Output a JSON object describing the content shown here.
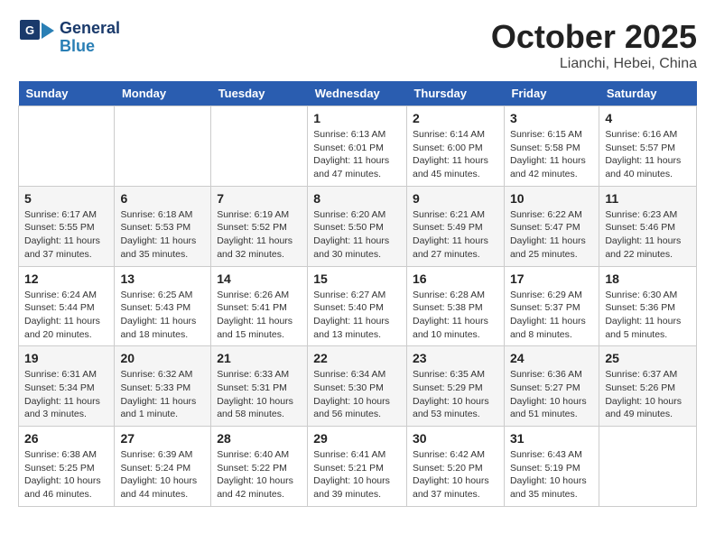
{
  "header": {
    "logo_line1": "General",
    "logo_line2": "Blue",
    "month": "October 2025",
    "location": "Lianchi, Hebei, China"
  },
  "days_of_week": [
    "Sunday",
    "Monday",
    "Tuesday",
    "Wednesday",
    "Thursday",
    "Friday",
    "Saturday"
  ],
  "weeks": [
    [
      {
        "day": "",
        "info": ""
      },
      {
        "day": "",
        "info": ""
      },
      {
        "day": "",
        "info": ""
      },
      {
        "day": "1",
        "info": "Sunrise: 6:13 AM\nSunset: 6:01 PM\nDaylight: 11 hours and 47 minutes."
      },
      {
        "day": "2",
        "info": "Sunrise: 6:14 AM\nSunset: 6:00 PM\nDaylight: 11 hours and 45 minutes."
      },
      {
        "day": "3",
        "info": "Sunrise: 6:15 AM\nSunset: 5:58 PM\nDaylight: 11 hours and 42 minutes."
      },
      {
        "day": "4",
        "info": "Sunrise: 6:16 AM\nSunset: 5:57 PM\nDaylight: 11 hours and 40 minutes."
      }
    ],
    [
      {
        "day": "5",
        "info": "Sunrise: 6:17 AM\nSunset: 5:55 PM\nDaylight: 11 hours and 37 minutes."
      },
      {
        "day": "6",
        "info": "Sunrise: 6:18 AM\nSunset: 5:53 PM\nDaylight: 11 hours and 35 minutes."
      },
      {
        "day": "7",
        "info": "Sunrise: 6:19 AM\nSunset: 5:52 PM\nDaylight: 11 hours and 32 minutes."
      },
      {
        "day": "8",
        "info": "Sunrise: 6:20 AM\nSunset: 5:50 PM\nDaylight: 11 hours and 30 minutes."
      },
      {
        "day": "9",
        "info": "Sunrise: 6:21 AM\nSunset: 5:49 PM\nDaylight: 11 hours and 27 minutes."
      },
      {
        "day": "10",
        "info": "Sunrise: 6:22 AM\nSunset: 5:47 PM\nDaylight: 11 hours and 25 minutes."
      },
      {
        "day": "11",
        "info": "Sunrise: 6:23 AM\nSunset: 5:46 PM\nDaylight: 11 hours and 22 minutes."
      }
    ],
    [
      {
        "day": "12",
        "info": "Sunrise: 6:24 AM\nSunset: 5:44 PM\nDaylight: 11 hours and 20 minutes."
      },
      {
        "day": "13",
        "info": "Sunrise: 6:25 AM\nSunset: 5:43 PM\nDaylight: 11 hours and 18 minutes."
      },
      {
        "day": "14",
        "info": "Sunrise: 6:26 AM\nSunset: 5:41 PM\nDaylight: 11 hours and 15 minutes."
      },
      {
        "day": "15",
        "info": "Sunrise: 6:27 AM\nSunset: 5:40 PM\nDaylight: 11 hours and 13 minutes."
      },
      {
        "day": "16",
        "info": "Sunrise: 6:28 AM\nSunset: 5:38 PM\nDaylight: 11 hours and 10 minutes."
      },
      {
        "day": "17",
        "info": "Sunrise: 6:29 AM\nSunset: 5:37 PM\nDaylight: 11 hours and 8 minutes."
      },
      {
        "day": "18",
        "info": "Sunrise: 6:30 AM\nSunset: 5:36 PM\nDaylight: 11 hours and 5 minutes."
      }
    ],
    [
      {
        "day": "19",
        "info": "Sunrise: 6:31 AM\nSunset: 5:34 PM\nDaylight: 11 hours and 3 minutes."
      },
      {
        "day": "20",
        "info": "Sunrise: 6:32 AM\nSunset: 5:33 PM\nDaylight: 11 hours and 1 minute."
      },
      {
        "day": "21",
        "info": "Sunrise: 6:33 AM\nSunset: 5:31 PM\nDaylight: 10 hours and 58 minutes."
      },
      {
        "day": "22",
        "info": "Sunrise: 6:34 AM\nSunset: 5:30 PM\nDaylight: 10 hours and 56 minutes."
      },
      {
        "day": "23",
        "info": "Sunrise: 6:35 AM\nSunset: 5:29 PM\nDaylight: 10 hours and 53 minutes."
      },
      {
        "day": "24",
        "info": "Sunrise: 6:36 AM\nSunset: 5:27 PM\nDaylight: 10 hours and 51 minutes."
      },
      {
        "day": "25",
        "info": "Sunrise: 6:37 AM\nSunset: 5:26 PM\nDaylight: 10 hours and 49 minutes."
      }
    ],
    [
      {
        "day": "26",
        "info": "Sunrise: 6:38 AM\nSunset: 5:25 PM\nDaylight: 10 hours and 46 minutes."
      },
      {
        "day": "27",
        "info": "Sunrise: 6:39 AM\nSunset: 5:24 PM\nDaylight: 10 hours and 44 minutes."
      },
      {
        "day": "28",
        "info": "Sunrise: 6:40 AM\nSunset: 5:22 PM\nDaylight: 10 hours and 42 minutes."
      },
      {
        "day": "29",
        "info": "Sunrise: 6:41 AM\nSunset: 5:21 PM\nDaylight: 10 hours and 39 minutes."
      },
      {
        "day": "30",
        "info": "Sunrise: 6:42 AM\nSunset: 5:20 PM\nDaylight: 10 hours and 37 minutes."
      },
      {
        "day": "31",
        "info": "Sunrise: 6:43 AM\nSunset: 5:19 PM\nDaylight: 10 hours and 35 minutes."
      },
      {
        "day": "",
        "info": ""
      }
    ]
  ]
}
